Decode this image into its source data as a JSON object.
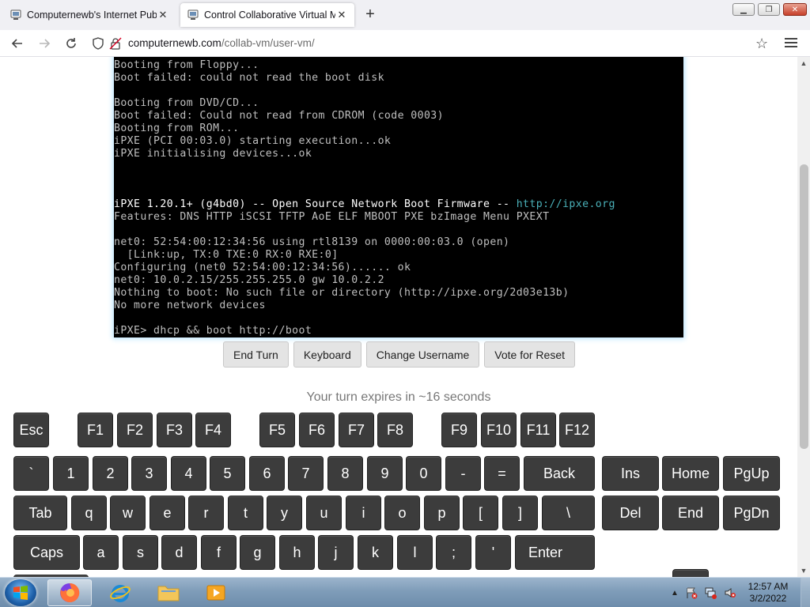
{
  "browser": {
    "tabs": [
      {
        "label": "Computernewb's Internet Pub I"
      },
      {
        "label": "Control Collaborative Virtual M"
      }
    ],
    "new_tab": "+",
    "window_controls": {
      "minimize": "▁",
      "maximize": "❐",
      "close": "✕"
    },
    "url_host": "computernewb.com",
    "url_path": "/collab-vm/user-vm/"
  },
  "vm_screen": {
    "lines": [
      "Booting from Floppy...",
      "Boot failed: could not read the boot disk",
      "",
      "Booting from DVD/CD...",
      "Boot failed: Could not read from CDROM (code 0003)",
      "Booting from ROM...",
      "iPXE (PCI 00:03.0) starting execution...ok",
      "iPXE initialising devices...ok",
      "",
      "",
      "",
      "",
      "Features: DNS HTTP iSCSI TFTP AoE ELF MBOOT PXE bzImage Menu PXEXT",
      "",
      "net0: 52:54:00:12:34:56 using rtl8139 on 0000:00:03.0 (open)",
      "  [Link:up, TX:0 TXE:0 RX:0 RXE:0]",
      "Configuring (net0 52:54:00:12:34:56)...... ok",
      "net0: 10.0.2.15/255.255.255.0 gw 10.0.2.2",
      "Nothing to boot: No such file or directory (http://ipxe.org/2d03e13b)",
      "No more network devices",
      "",
      "iPXE> dhcp && boot http://boot"
    ],
    "ipxe_banner_prefix": "iPXE 1.20.1+ (g4bd0)",
    "ipxe_banner_middle": " -- Open Source Network Boot Firmware -- ",
    "ipxe_banner_link": "http://ipxe.org"
  },
  "vm_buttons": {
    "end_turn": "End Turn",
    "keyboard": "Keyboard",
    "change_username": "Change Username",
    "vote_reset": "Vote for Reset"
  },
  "turn_status": "Your turn expires in ~16 seconds",
  "keyboard_keys": {
    "esc": "Esc",
    "f1": "F1",
    "f2": "F2",
    "f3": "F3",
    "f4": "F4",
    "f5": "F5",
    "f6": "F6",
    "f7": "F7",
    "f8": "F8",
    "f9": "F9",
    "f10": "F10",
    "f11": "F11",
    "f12": "F12",
    "backtick": "`",
    "n1": "1",
    "n2": "2",
    "n3": "3",
    "n4": "4",
    "n5": "5",
    "n6": "6",
    "n7": "7",
    "n8": "8",
    "n9": "9",
    "n0": "0",
    "minus": "-",
    "equals": "=",
    "back": "Back",
    "ins": "Ins",
    "home": "Home",
    "pgup": "PgUp",
    "tab": "Tab",
    "q": "q",
    "w": "w",
    "e": "e",
    "r": "r",
    "t": "t",
    "y": "y",
    "u": "u",
    "i": "i",
    "o": "o",
    "p": "p",
    "lbracket": "[",
    "rbracket": "]",
    "backslash": "\\",
    "del": "Del",
    "end": "End",
    "pgdn": "PgDn",
    "caps": "Caps",
    "a": "a",
    "s": "s",
    "d": "d",
    "f": "f",
    "g": "g",
    "h": "h",
    "j": "j",
    "k": "k",
    "l": "l",
    "semicolon": ";",
    "quote": "'",
    "enter": "Enter"
  },
  "taskbar": {
    "clock_time": "12:57 AM",
    "clock_date": "3/2/2022"
  }
}
